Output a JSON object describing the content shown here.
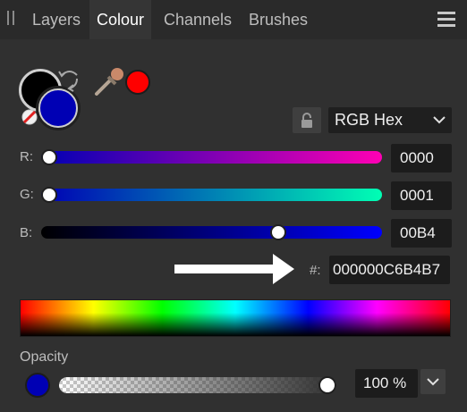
{
  "tabs": [
    {
      "label": "Layers",
      "active": false
    },
    {
      "label": "Colour",
      "active": true
    },
    {
      "label": "Channels",
      "active": false
    },
    {
      "label": "Brushes",
      "active": false
    }
  ],
  "colors": {
    "primary": "#000000",
    "secondary": "#0000B4",
    "picked": "#FF0000",
    "bar_bg": "#2a2a2a",
    "panel_bg": "#303030"
  },
  "color_model": {
    "selected": "RGB Hex"
  },
  "channels": {
    "r": {
      "label": "R:",
      "value": "0000",
      "level": 0.0
    },
    "g": {
      "label": "G:",
      "value": "0001",
      "level": 0.0
    },
    "b": {
      "label": "B:",
      "value": "00B4",
      "level": 0.706
    }
  },
  "hex": {
    "label": "#:",
    "value": "000000C6B4B7"
  },
  "opacity": {
    "label": "Opacity",
    "value": "100 %",
    "level": 1.0
  },
  "icons": {
    "grip": "panel-grip-icon",
    "menu": "hamburger-menu-icon",
    "swap": "swap-arrows-icon",
    "no_fill": "no-fill-icon",
    "eyedropper": "eyedropper-icon",
    "lock": "padlock-icon",
    "chevron": "chevron-down-icon",
    "arrow": "right-arrow-annotation"
  }
}
